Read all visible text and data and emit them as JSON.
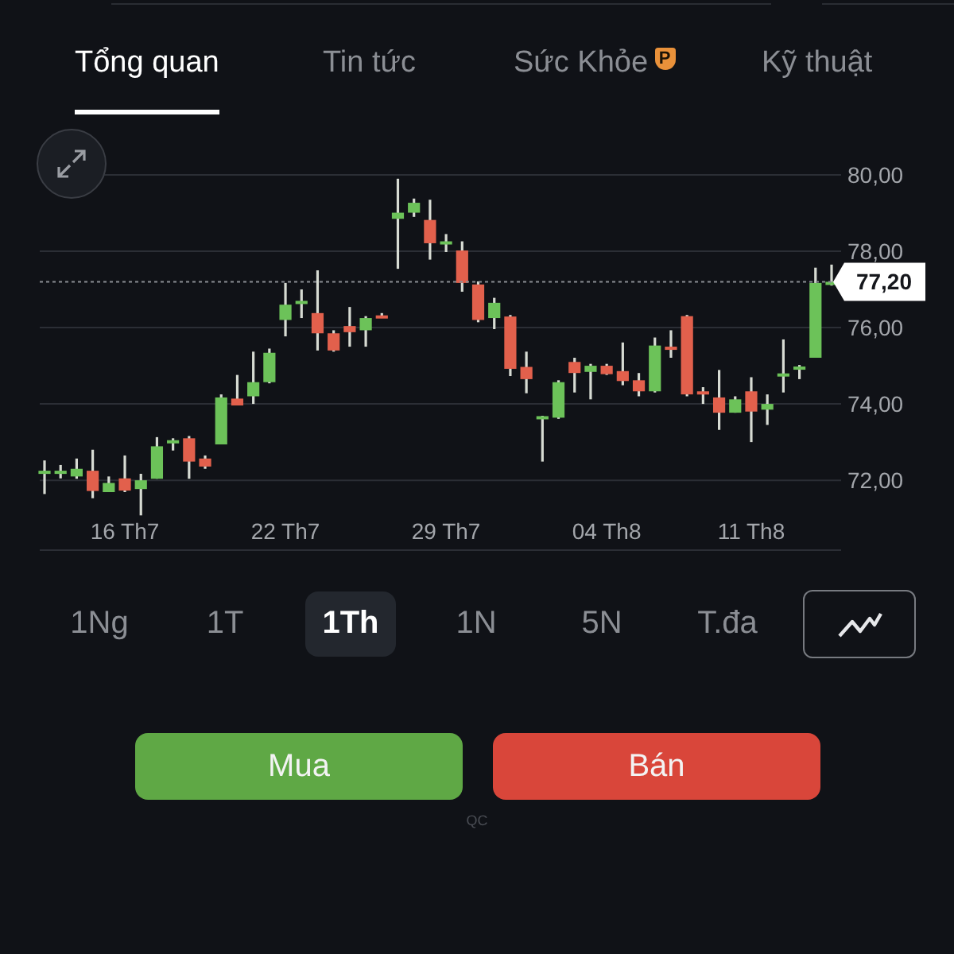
{
  "tabs": [
    {
      "label": "Tổng quan",
      "selected": true
    },
    {
      "label": "Tin tức",
      "selected": false
    },
    {
      "label": "Sức Khỏe",
      "selected": false,
      "badge": "P"
    },
    {
      "label": "Kỹ thuật",
      "selected": false
    }
  ],
  "chart": {
    "chart_data": {
      "type": "candlestick",
      "grid": true,
      "ylim": [
        70.17,
        80
      ],
      "yticks": [
        {
          "value": 80,
          "label": "80,00"
        },
        {
          "value": 78,
          "label": "78,00"
        },
        {
          "value": 76,
          "label": "76,00"
        },
        {
          "value": 74,
          "label": "74,00"
        },
        {
          "value": 72,
          "label": "72,00"
        }
      ],
      "categories": [
        null,
        null,
        null,
        null,
        null,
        "16 Th7",
        null,
        null,
        null,
        null,
        null,
        null,
        null,
        null,
        null,
        "22 Th7",
        null,
        null,
        null,
        null,
        null,
        null,
        null,
        null,
        null,
        "29 Th7",
        null,
        null,
        null,
        null,
        null,
        null,
        null,
        null,
        null,
        "04 Th8",
        null,
        null,
        null,
        null,
        null,
        null,
        null,
        null,
        "11 Th8",
        null,
        null,
        null,
        null,
        null
      ],
      "ohlc": [
        [
          72.17,
          72.52,
          71.64,
          72.25
        ],
        [
          72.2,
          72.4,
          72.05,
          72.25
        ],
        [
          72.1,
          72.57,
          72.04,
          72.3
        ],
        [
          72.25,
          72.8,
          71.53,
          71.72
        ],
        [
          71.69,
          72.1,
          71.69,
          71.93
        ],
        [
          72.05,
          72.65,
          71.69,
          71.73
        ],
        [
          71.77,
          72.17,
          71.08,
          72.0
        ],
        [
          72.04,
          73.13,
          72.04,
          72.89
        ],
        [
          72.97,
          73.1,
          72.78,
          73.05
        ],
        [
          73.1,
          73.16,
          72.04,
          72.49
        ],
        [
          72.57,
          72.65,
          72.3,
          72.36
        ],
        [
          72.94,
          74.25,
          72.94,
          74.17
        ],
        [
          74.14,
          74.76,
          73.96,
          73.96
        ],
        [
          74.2,
          75.37,
          74.0,
          74.57
        ],
        [
          74.57,
          75.45,
          74.54,
          75.34
        ],
        [
          76.2,
          77.17,
          75.77,
          76.6
        ],
        [
          76.65,
          77.0,
          76.25,
          76.7
        ],
        [
          76.38,
          77.5,
          75.4,
          75.85
        ],
        [
          75.85,
          75.93,
          75.37,
          75.4
        ],
        [
          76.04,
          76.54,
          75.5,
          75.88
        ],
        [
          75.93,
          76.3,
          75.5,
          76.25
        ],
        [
          76.32,
          76.38,
          76.25,
          76.28
        ],
        [
          78.85,
          79.9,
          77.54,
          79.01
        ],
        [
          79.01,
          79.38,
          78.9,
          79.27
        ],
        [
          78.82,
          79.35,
          77.78,
          78.21
        ],
        [
          78.2,
          78.45,
          77.98,
          78.26
        ],
        [
          78.02,
          78.26,
          76.94,
          77.17
        ],
        [
          77.13,
          77.21,
          76.14,
          76.2
        ],
        [
          76.25,
          76.78,
          75.96,
          76.65
        ],
        [
          76.29,
          76.33,
          74.73,
          74.92
        ],
        [
          74.97,
          75.37,
          74.28,
          74.65
        ],
        [
          73.6,
          73.69,
          72.49,
          73.68
        ],
        [
          73.64,
          74.62,
          73.61,
          74.57
        ],
        [
          75.1,
          75.21,
          74.3,
          74.81
        ],
        [
          74.84,
          75.05,
          74.12,
          75.0
        ],
        [
          75.0,
          75.05,
          74.76,
          74.78
        ],
        [
          74.86,
          75.61,
          74.49,
          74.6
        ],
        [
          74.62,
          74.81,
          74.2,
          74.33
        ],
        [
          74.33,
          75.74,
          74.3,
          75.53
        ],
        [
          75.5,
          75.93,
          75.21,
          75.45
        ],
        [
          76.3,
          76.33,
          74.2,
          74.25
        ],
        [
          74.33,
          74.44,
          74.0,
          74.3
        ],
        [
          74.17,
          74.89,
          73.32,
          73.77
        ],
        [
          73.77,
          74.2,
          73.77,
          74.12
        ],
        [
          74.33,
          74.7,
          73.0,
          73.8
        ],
        [
          73.85,
          74.25,
          73.45,
          74.0
        ],
        [
          74.75,
          75.69,
          74.3,
          74.8
        ],
        [
          74.9,
          75.02,
          74.65,
          74.98
        ],
        [
          75.21,
          77.57,
          75.21,
          77.17
        ],
        [
          77.17,
          77.65,
          77.1,
          77.2
        ]
      ],
      "ref_lines": [
        {
          "axis": "y",
          "value": 77.2,
          "label": "77,20"
        }
      ]
    }
  },
  "ranges": [
    {
      "label": "1Ng",
      "selected": false
    },
    {
      "label": "1T",
      "selected": false
    },
    {
      "label": "1Th",
      "selected": true
    },
    {
      "label": "1N",
      "selected": false
    },
    {
      "label": "5N",
      "selected": false
    },
    {
      "label": "T.đa",
      "selected": false
    }
  ],
  "actions": [
    {
      "label": "Mua",
      "kind": "buy"
    },
    {
      "label": "Bán",
      "kind": "sell"
    }
  ],
  "ad_label": "QC"
}
